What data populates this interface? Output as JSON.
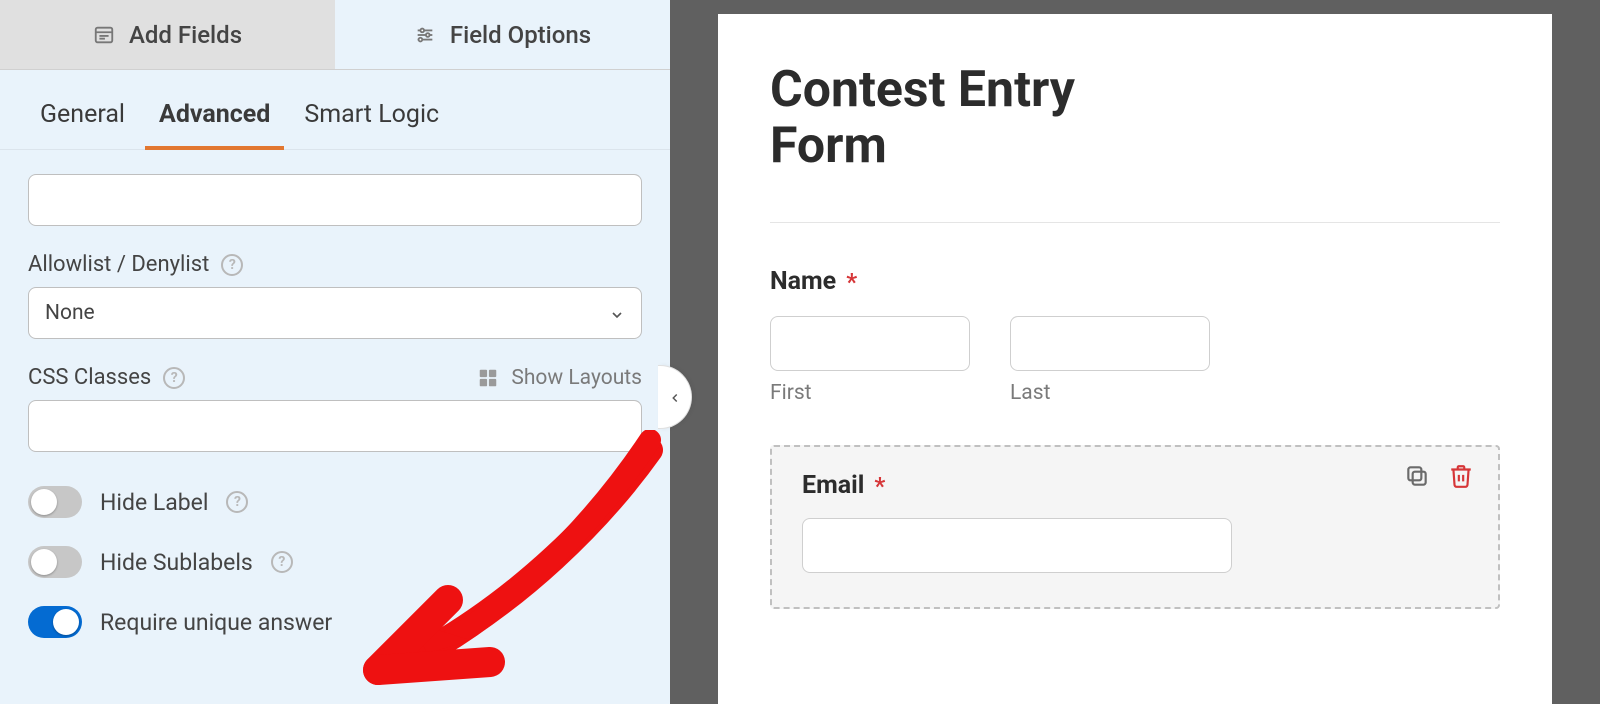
{
  "top_tabs": {
    "add_fields": "Add Fields",
    "field_options": "Field Options"
  },
  "sub_tabs": {
    "general": "General",
    "advanced": "Advanced",
    "smart_logic": "Smart Logic"
  },
  "fields": {
    "allowlist_label": "Allowlist / Denylist",
    "allowlist_value": "None",
    "css_classes_label": "CSS Classes",
    "show_layouts": "Show Layouts"
  },
  "toggles": {
    "hide_label": "Hide Label",
    "hide_sublabels": "Hide Sublabels",
    "require_unique": "Require unique answer"
  },
  "preview": {
    "title_line1": "Contest Entry",
    "title_line2": "Form",
    "name_label": "Name",
    "first_sub": "First",
    "last_sub": "Last",
    "email_label": "Email",
    "required_mark": "*"
  }
}
